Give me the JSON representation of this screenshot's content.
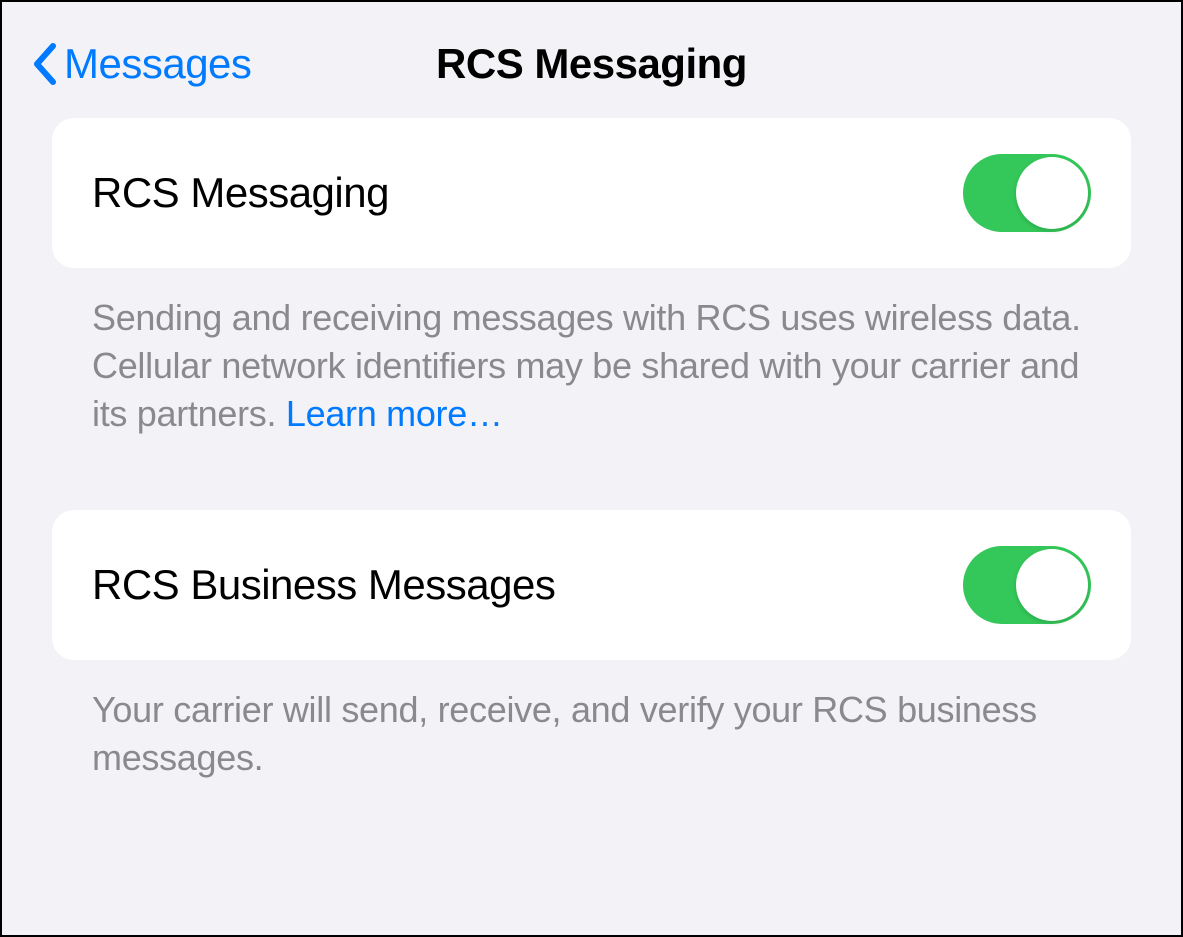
{
  "header": {
    "back_label": "Messages",
    "title": "RCS Messaging"
  },
  "sections": [
    {
      "label": "RCS Messaging",
      "toggle_on": true,
      "footer": "Sending and receiving messages with RCS uses wireless data. Cellular network identifiers may be shared with your carrier and its partners. ",
      "learn_more": "Learn more…"
    },
    {
      "label": "RCS Business Messages",
      "toggle_on": true,
      "footer": "Your carrier will send, receive, and verify your RCS business messages."
    }
  ]
}
